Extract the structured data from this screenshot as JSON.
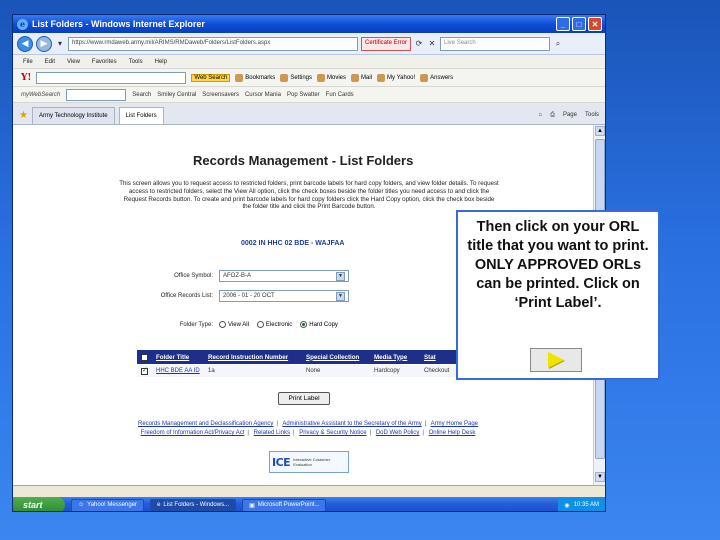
{
  "window": {
    "title": "List Folders - Windows Internet Explorer",
    "url": "https://www.rmdaweb.army.mil/ARIMS/RMDaweb/Folders/ListFolders.aspx",
    "cert_error": "Certificate Error",
    "live_search_placeholder": "Live Search"
  },
  "menu": [
    "File",
    "Edit",
    "View",
    "Favorites",
    "Tools",
    "Help"
  ],
  "yahoo_toolbar": {
    "logo": "Y!",
    "items": [
      "Web Search",
      "Bookmarks",
      "Settings",
      "Movies",
      "Mail",
      "My Yahoo!",
      "Answers"
    ]
  },
  "myweb_toolbar": {
    "label": "myWebSearch",
    "items": [
      "Search",
      "Smiley Central",
      "Screensavers",
      "Cursor Mania",
      "Pop Swatter",
      "Fun Cards"
    ]
  },
  "tabs": [
    {
      "label": "Army Technology Institute"
    },
    {
      "label": "List Folders"
    }
  ],
  "tab_tools": [
    "Page",
    "Tools"
  ],
  "page": {
    "title": "Records Management - List Folders",
    "intro": "This screen allows you to request access to restricted folders, print barcode labels for hard copy folders, and view folder details. To request access to restricted folders, select the View All option, click the check boxes beside the folder titles you need access to and click the Request Records button. To create and print barcode labels for hard copy folders click the Hard Copy option, click the check box beside the folder title and click the Print Barcode button.",
    "unit": "0002 IN HHC 02 BDE - WAJFAA",
    "office_symbol_label": "Office Symbol:",
    "office_symbol_value": "AFOZ-B-A",
    "records_list_label": "Office Records List:",
    "records_list_value": "2006 - 01 - 20 OCT",
    "folder_type_label": "Folder Type:",
    "folder_types": [
      "View All",
      "Electronic",
      "Hard Copy"
    ],
    "table": {
      "headers": [
        "Folder Title",
        "Record Instruction Number",
        "Special Collection",
        "Media Type",
        "Stat"
      ],
      "rows": [
        [
          "HHC BDE AA ID",
          "1a",
          "None",
          "Hardcopy",
          "Checkout"
        ]
      ]
    },
    "print_button": "Print Label",
    "footer_links_line1": [
      "Records Management and Declassification Agency",
      "Administrative Assistant to the Secretary of the Army",
      "Army Home Page"
    ],
    "footer_links_line2": [
      "Freedom of Information Act/Privacy Act",
      "Related Links",
      "Privacy & Security Notice",
      "DoD Web Policy",
      "Online Help Desk"
    ],
    "ice_logo": "ICE",
    "ice_text": "Interactive Customer Evaluation"
  },
  "statusbar": {
    "text": ""
  },
  "taskbar": {
    "start": "start",
    "tasks": [
      "Yahoo! Messenger",
      "List Folders - Windows...",
      "Microsoft PowerPoint..."
    ],
    "clock": "10:35 AM"
  },
  "callout": {
    "text": "Then click on your ORL title that you want to print. ONLY APPROVED ORLs can be printed. Click on ‘Print Label’."
  }
}
